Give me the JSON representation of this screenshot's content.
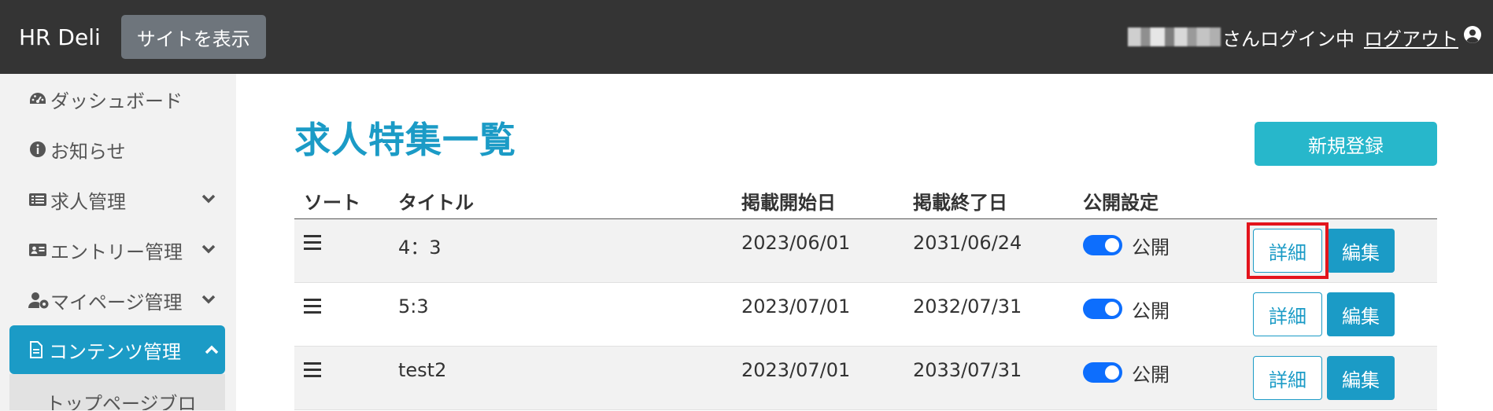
{
  "header": {
    "brand": "HR Deli",
    "view_site_label": "サイトを表示",
    "login_status": "さんログイン中",
    "logout_label": "ログアウト"
  },
  "sidebar": {
    "items": [
      {
        "label": "ダッシュボード",
        "icon": "gauge-icon"
      },
      {
        "label": "お知らせ",
        "icon": "info-circle-icon"
      },
      {
        "label": "求人管理",
        "icon": "list-alt-icon"
      },
      {
        "label": "エントリー管理",
        "icon": "id-card-icon"
      },
      {
        "label": "マイページ管理",
        "icon": "user-cog-icon"
      },
      {
        "label": "コンテンツ管理",
        "icon": "file-alt-icon"
      }
    ],
    "sub_item": "トップページブロ"
  },
  "main": {
    "title": "求人特集一覧",
    "new_button": "新規登録",
    "columns": [
      "ソート",
      "タイトル",
      "掲載開始日",
      "掲載終了日",
      "公開設定"
    ],
    "rows": [
      {
        "title": "4：3",
        "start": "2023/06/01",
        "end": "2031/06/24",
        "status": "公開",
        "published": true
      },
      {
        "title": "5:3",
        "start": "2023/07/01",
        "end": "2032/07/31",
        "status": "公開",
        "published": true
      },
      {
        "title": "test2",
        "start": "2023/07/01",
        "end": "2033/07/31",
        "status": "公開",
        "published": true
      }
    ],
    "detail_label": "詳細",
    "edit_label": "編集"
  },
  "colors": {
    "topbar": "#343434",
    "accent": "#1b9bc6",
    "new_button": "#27b7cb",
    "toggle_on": "#0d6efd",
    "highlight": "#e3141c"
  }
}
